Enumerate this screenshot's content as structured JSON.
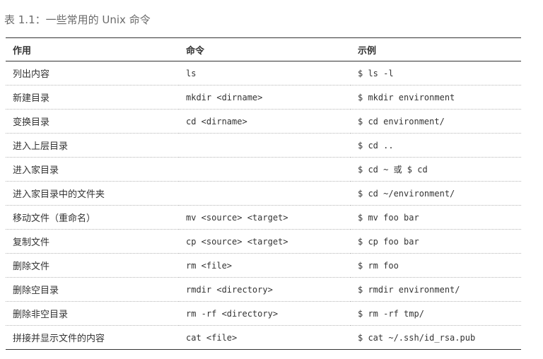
{
  "caption": "表 1.1：一些常用的 Unix 命令",
  "table": {
    "headers": [
      "作用",
      "命令",
      "示例"
    ],
    "rows": [
      {
        "purpose": "列出内容",
        "command": "ls",
        "example": "$ ls -l"
      },
      {
        "purpose": "新建目录",
        "command": "mkdir <dirname>",
        "example": "$ mkdir environment"
      },
      {
        "purpose": "变换目录",
        "command": "cd <dirname>",
        "example": "$ cd environment/"
      },
      {
        "purpose": "进入上层目录",
        "command": "",
        "example": "$ cd .."
      },
      {
        "purpose": "进入家目录",
        "command": "",
        "example": "$ cd ~ 或 $ cd"
      },
      {
        "purpose": "进入家目录中的文件夹",
        "command": "",
        "example": "$ cd ~/environment/"
      },
      {
        "purpose": "移动文件（重命名）",
        "command": "mv <source> <target>",
        "example": "$ mv foo bar"
      },
      {
        "purpose": "复制文件",
        "command": "cp <source> <target>",
        "example": "$ cp foo bar"
      },
      {
        "purpose": "删除文件",
        "command": "rm <file>",
        "example": "$ rm foo"
      },
      {
        "purpose": "删除空目录",
        "command": "rmdir <directory>",
        "example": "$ rmdir environment/"
      },
      {
        "purpose": "删除非空目录",
        "command": "rm -rf <directory>",
        "example": "$ rm -rf tmp/"
      },
      {
        "purpose": "拼接并显示文件的内容",
        "command": "cat <file>",
        "example": "$ cat ~/.ssh/id_rsa.pub"
      }
    ]
  },
  "colors": {
    "text": "#333333",
    "caption": "#6b6b6b",
    "rule": "#333333",
    "row_divider": "#b5b5b5"
  }
}
